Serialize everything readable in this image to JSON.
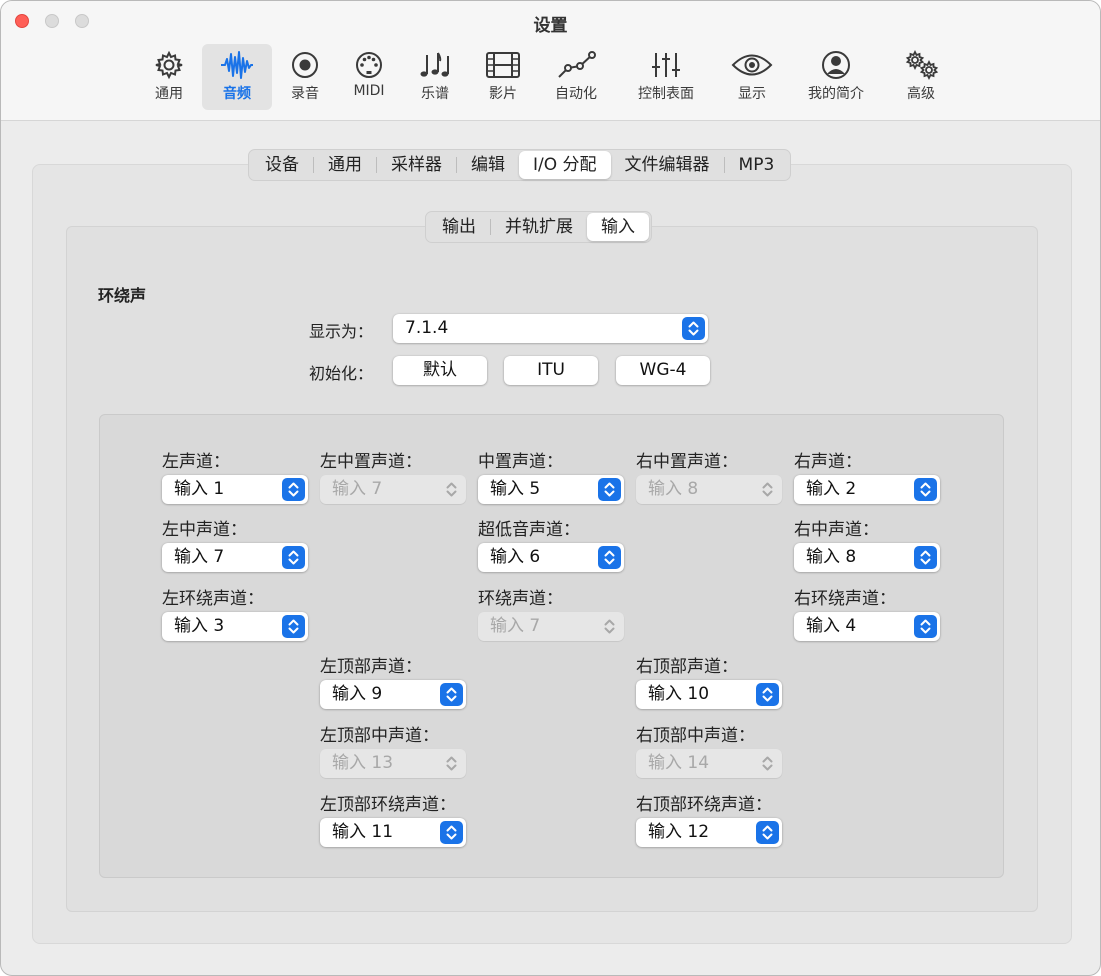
{
  "window": {
    "title": "设置"
  },
  "toolbar": {
    "items": [
      {
        "label": "通用",
        "icon": "gear-icon"
      },
      {
        "label": "音频",
        "icon": "waveform-icon",
        "active": true
      },
      {
        "label": "录音",
        "icon": "record-icon"
      },
      {
        "label": "MIDI",
        "icon": "midi-port-icon"
      },
      {
        "label": "乐谱",
        "icon": "music-notes-icon"
      },
      {
        "label": "影片",
        "icon": "film-icon"
      },
      {
        "label": "自动化",
        "icon": "automation-curve-icon"
      },
      {
        "label": "控制表面",
        "icon": "sliders-icon"
      },
      {
        "label": "显示",
        "icon": "eye-icon"
      },
      {
        "label": "我的简介",
        "icon": "profile-icon"
      },
      {
        "label": "高级",
        "icon": "gears-icon"
      }
    ]
  },
  "tabs": [
    "设备",
    "通用",
    "采样器",
    "编辑",
    "I/O 分配",
    "文件编辑器",
    "MP3"
  ],
  "selected_tab": "I/O 分配",
  "subtabs": [
    "输出",
    "并轨扩展",
    "输入"
  ],
  "selected_subtab": "输入",
  "surround": {
    "title": "环绕声",
    "display_as_label": "显示为：",
    "display_as_value": "7.1.4",
    "init_label": "初始化：",
    "init_buttons": [
      "默认",
      "ITU",
      "WG-4"
    ]
  },
  "channels": {
    "left": {
      "label": "左声道：",
      "value": "输入 1",
      "enabled": true
    },
    "left_center": {
      "label": "左中置声道：",
      "value": "输入 7",
      "enabled": false
    },
    "center": {
      "label": "中置声道：",
      "value": "输入 5",
      "enabled": true
    },
    "right_center": {
      "label": "右中置声道：",
      "value": "输入 8",
      "enabled": false
    },
    "right": {
      "label": "右声道：",
      "value": "输入 2",
      "enabled": true
    },
    "left_mid": {
      "label": "左中声道：",
      "value": "输入 7",
      "enabled": true
    },
    "lfe": {
      "label": "超低音声道：",
      "value": "输入 6",
      "enabled": true
    },
    "right_mid": {
      "label": "右中声道：",
      "value": "输入 8",
      "enabled": true
    },
    "left_surround": {
      "label": "左环绕声道：",
      "value": "输入 3",
      "enabled": true
    },
    "surround": {
      "label": "环绕声道：",
      "value": "输入 7",
      "enabled": false
    },
    "right_surround": {
      "label": "右环绕声道：",
      "value": "输入 4",
      "enabled": true
    },
    "left_top": {
      "label": "左顶部声道：",
      "value": "输入 9",
      "enabled": true
    },
    "right_top": {
      "label": "右顶部声道：",
      "value": "输入 10",
      "enabled": true
    },
    "left_top_mid": {
      "label": "左顶部中声道：",
      "value": "输入 13",
      "enabled": false
    },
    "right_top_mid": {
      "label": "右顶部中声道：",
      "value": "输入 14",
      "enabled": false
    },
    "left_top_surround": {
      "label": "左顶部环绕声道：",
      "value": "输入 11",
      "enabled": true
    },
    "right_top_surround": {
      "label": "右顶部环绕声道：",
      "value": "输入 12",
      "enabled": true
    }
  },
  "colors": {
    "accent": "#1a73e8",
    "close": "#ff5f57"
  }
}
